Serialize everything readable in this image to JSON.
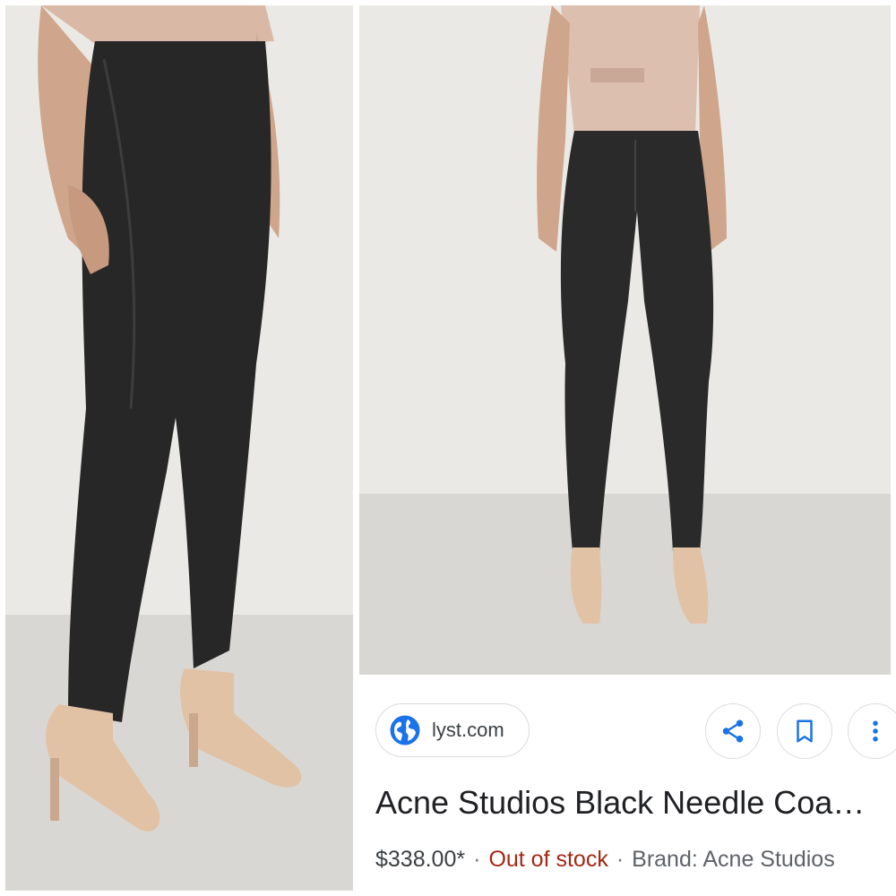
{
  "images": {
    "left": {
      "alt": "Side view of model wearing black coated skinny jeans and nude heels"
    },
    "right": {
      "alt": "Front view of model wearing black coated skinny jeans and nude heels"
    }
  },
  "result_card": {
    "source": {
      "icon": "globe-icon",
      "label": "lyst.com"
    },
    "actions": [
      {
        "icon": "share-icon"
      },
      {
        "icon": "bookmark-icon"
      },
      {
        "icon": "more-vert-icon"
      }
    ],
    "title": "Acne Studios Black Needle Coa…",
    "price": "$338.00*",
    "separator": "·",
    "stock": "Out of stock",
    "brand": "Brand: Acne Studios"
  },
  "colors": {
    "accent_blue": "#1a73e8",
    "stock_red": "#a52714",
    "jeans": "#2b2b2b",
    "backdrop": "#e9e6e2",
    "floor": "#d8d6d3"
  }
}
